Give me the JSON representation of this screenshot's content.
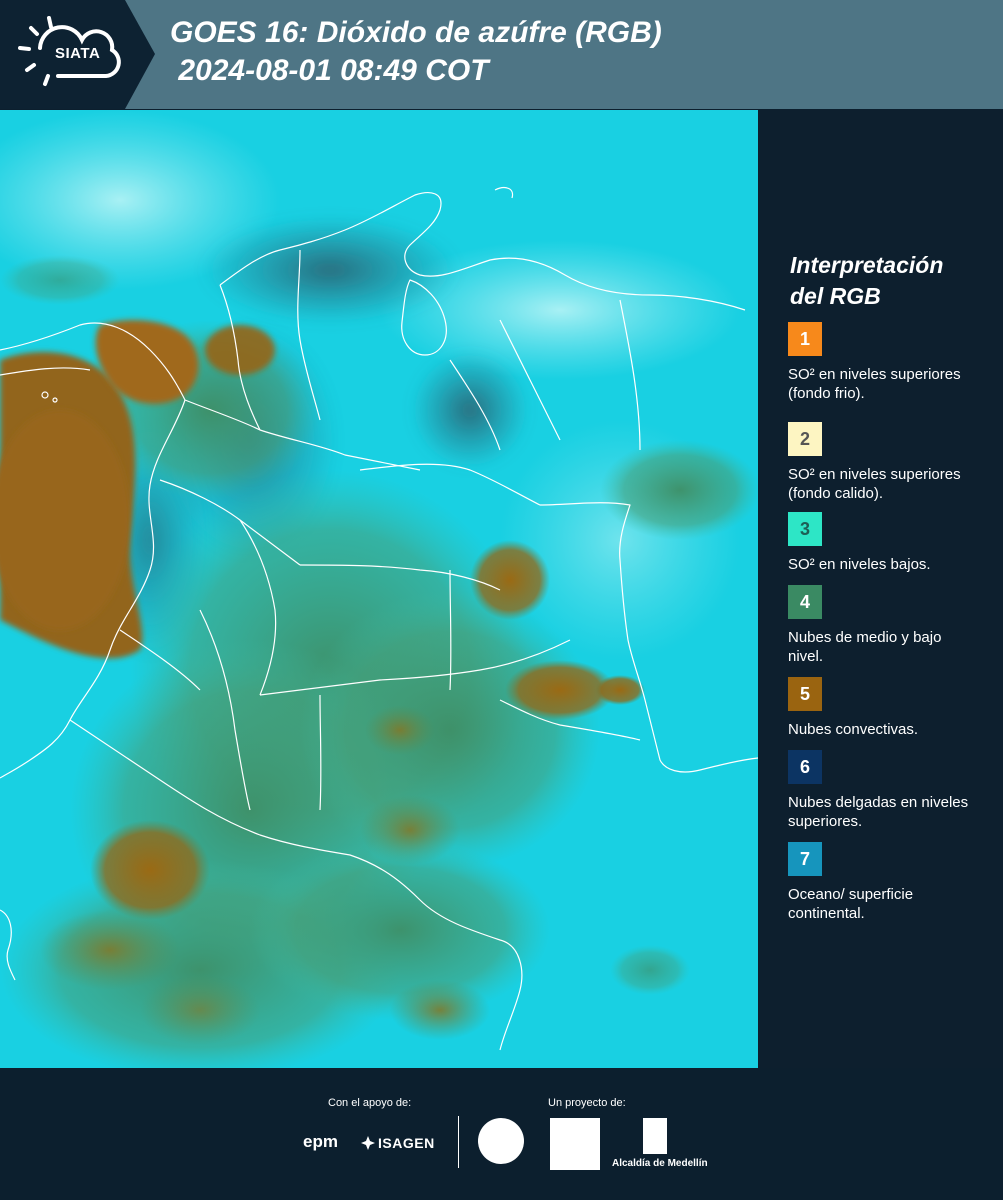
{
  "header": {
    "logo_text": "SIATA",
    "title_line1": "GOES 16: Dióxido de azúfre (RGB)",
    "title_line2": " 2024-08-01 08:49 COT"
  },
  "legend": {
    "title_line1": "Interpretación",
    "title_line2": "del RGB",
    "items": [
      {
        "number": "1",
        "color": "#f7891b",
        "text_color": "#ffffff",
        "description": "SO² en niveles superiores (fondo frio)."
      },
      {
        "number": "2",
        "color": "#fdf5c2",
        "text_color": "#555555",
        "description": "SO² en niveles superiores (fondo calido)."
      },
      {
        "number": "3",
        "color": "#2de6c6",
        "text_color": "#1d5f55",
        "description": "SO² en niveles bajos."
      },
      {
        "number": "4",
        "color": "#3a8a63",
        "text_color": "#ffffff",
        "description": "Nubes de medio y bajo nivel."
      },
      {
        "number": "5",
        "color": "#9a6410",
        "text_color": "#ffffff",
        "description": "Nubes convectivas."
      },
      {
        "number": "6",
        "color": "#0c3463",
        "text_color": "#ffffff",
        "description": "Nubes delgadas en niveles superiores."
      },
      {
        "number": "7",
        "color": "#1695bd",
        "text_color": "#ffffff",
        "description": "Oceano/ superficie continental."
      }
    ]
  },
  "footer": {
    "support_label": "Con el apoyo de:",
    "project_label": "Un proyecto de:",
    "epm_text": "epm",
    "isagen_text": "ISAGEN",
    "alcaldia_text": "Alcaldía de Medellín"
  },
  "colors": {
    "header_bg": "#4e7585",
    "panel_bg": "#0d1f2e",
    "map_base": "#17cde0"
  }
}
